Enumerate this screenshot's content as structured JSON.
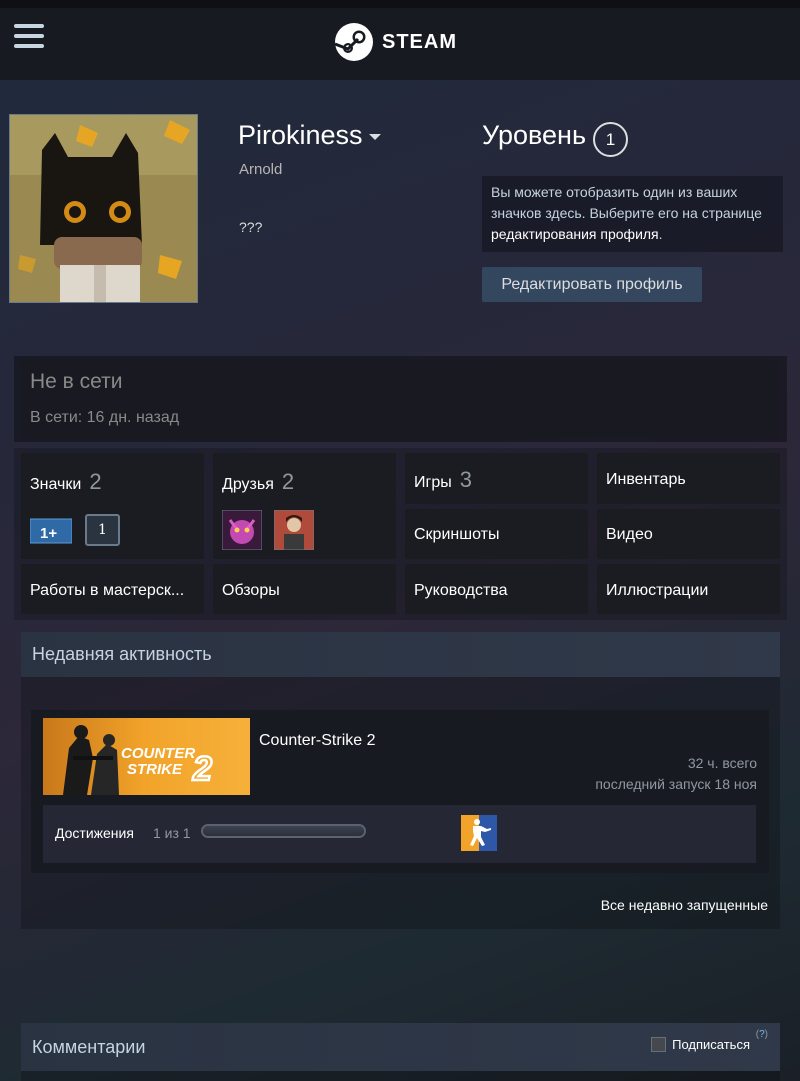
{
  "header": {
    "brand": "STEAM",
    "menu_icon": "hamburger-icon",
    "logo_icon": "steam-logo-icon"
  },
  "profile": {
    "persona_name": "Pirokiness",
    "real_name": "Arnold",
    "summary": "???",
    "level_label": "Уровень",
    "level_value": "1",
    "badge_hint_prefix": "Вы можете отобразить один из ваших значков здесь. Выберите его на странице ",
    "badge_hint_link": "редактирования профиля",
    "badge_hint_suffix": ".",
    "edit_button": "Редактировать профиль"
  },
  "status": {
    "title": "Не в сети",
    "last_online": "В сети: 16 дн. назад"
  },
  "tiles": {
    "badges": {
      "label": "Значки",
      "count": "2",
      "badge_level": "1"
    },
    "friends": {
      "label": "Друзья",
      "count": "2"
    },
    "games": {
      "label": "Игры",
      "count": "3"
    },
    "inventory": {
      "label": "Инвентарь"
    },
    "screenshots": {
      "label": "Скриншоты"
    },
    "videos": {
      "label": "Видео"
    },
    "workshop": {
      "label": "Работы в мастерск..."
    },
    "reviews": {
      "label": "Обзоры"
    },
    "guides": {
      "label": "Руководства"
    },
    "artwork": {
      "label": "Иллюстрации"
    }
  },
  "activity": {
    "title": "Недавняя активность",
    "game": {
      "name": "Counter-Strike 2",
      "hours": "32 ч. всего",
      "last_played": "последний запуск 18 ноя",
      "achievements_label": "Достижения",
      "achievements_count": "1 из 1",
      "achievements_progress": 1.0
    },
    "all_recent": "Все недавно запущенные"
  },
  "comments": {
    "title": "Комментарии",
    "subscribe": "Подписаться",
    "help": "?"
  },
  "colors": {
    "topbar": "#171a21",
    "tile_bg": "#1b1c22",
    "accent_blue": "#67c1f5"
  }
}
